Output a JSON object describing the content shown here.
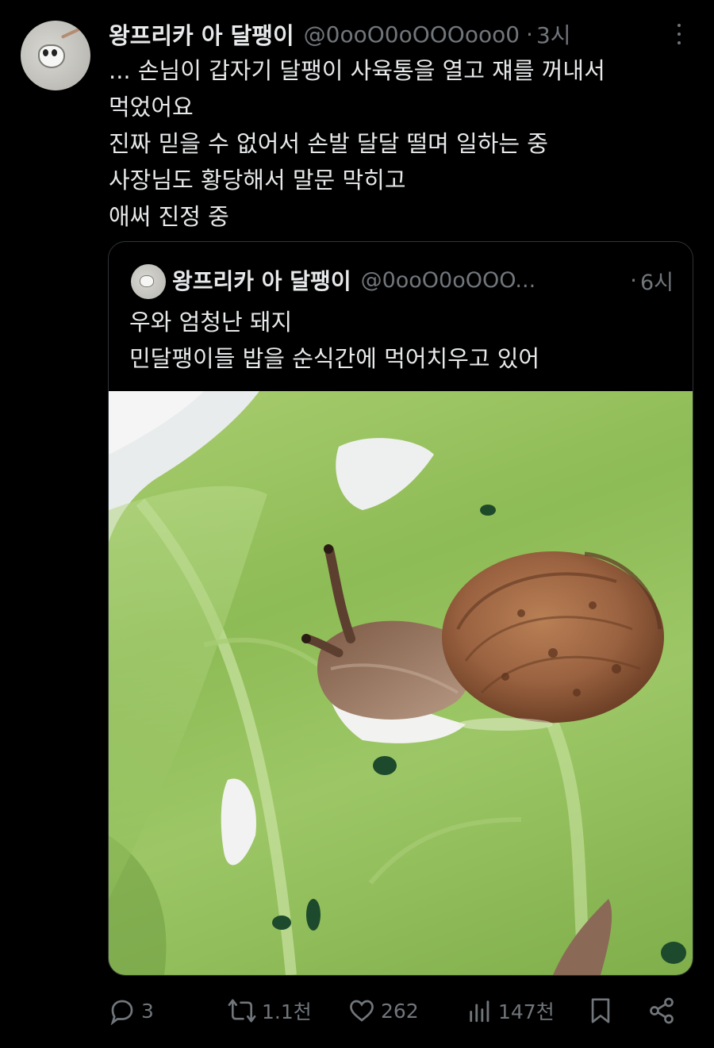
{
  "tweet": {
    "author_name": "왕프리카 아 달팽이",
    "handle": "@0ooO0oOOOooo0",
    "separator": "·",
    "time": "3시",
    "text_lines": [
      "... 손님이 갑자기 달팽이 사육통을 열고 쟤를 꺼내서",
      "먹었어요",
      "진짜 믿을 수 없어서 손발 달달 떨며 일하는 중",
      "사장님도 황당해서 말문 막히고",
      "애써 진정 중"
    ]
  },
  "quoted_tweet": {
    "author_name": "왕프리카 아 달팽이",
    "handle": "@0ooO0oOOO...",
    "separator": "·",
    "time": "6시",
    "text_lines": [
      "우와 엄청난 돼지",
      "민달팽이들 밥을 순식간에 먹어치우고 있어"
    ],
    "media": {
      "icon": "photo-snail-on-lettuce"
    }
  },
  "actions": {
    "reply_count": "3",
    "retweet_count": "1.1천",
    "like_count": "262",
    "view_count": "147천"
  },
  "icons": {
    "more": "more-dots-icon",
    "reply": "reply-icon",
    "retweet": "retweet-icon",
    "like": "heart-icon",
    "views": "views-icon",
    "bookmark": "bookmark-icon",
    "share": "share-icon"
  },
  "colors": {
    "background": "#000000",
    "text": "#e7e9ea",
    "secondary_text": "#71767b",
    "border": "#2f3336"
  }
}
